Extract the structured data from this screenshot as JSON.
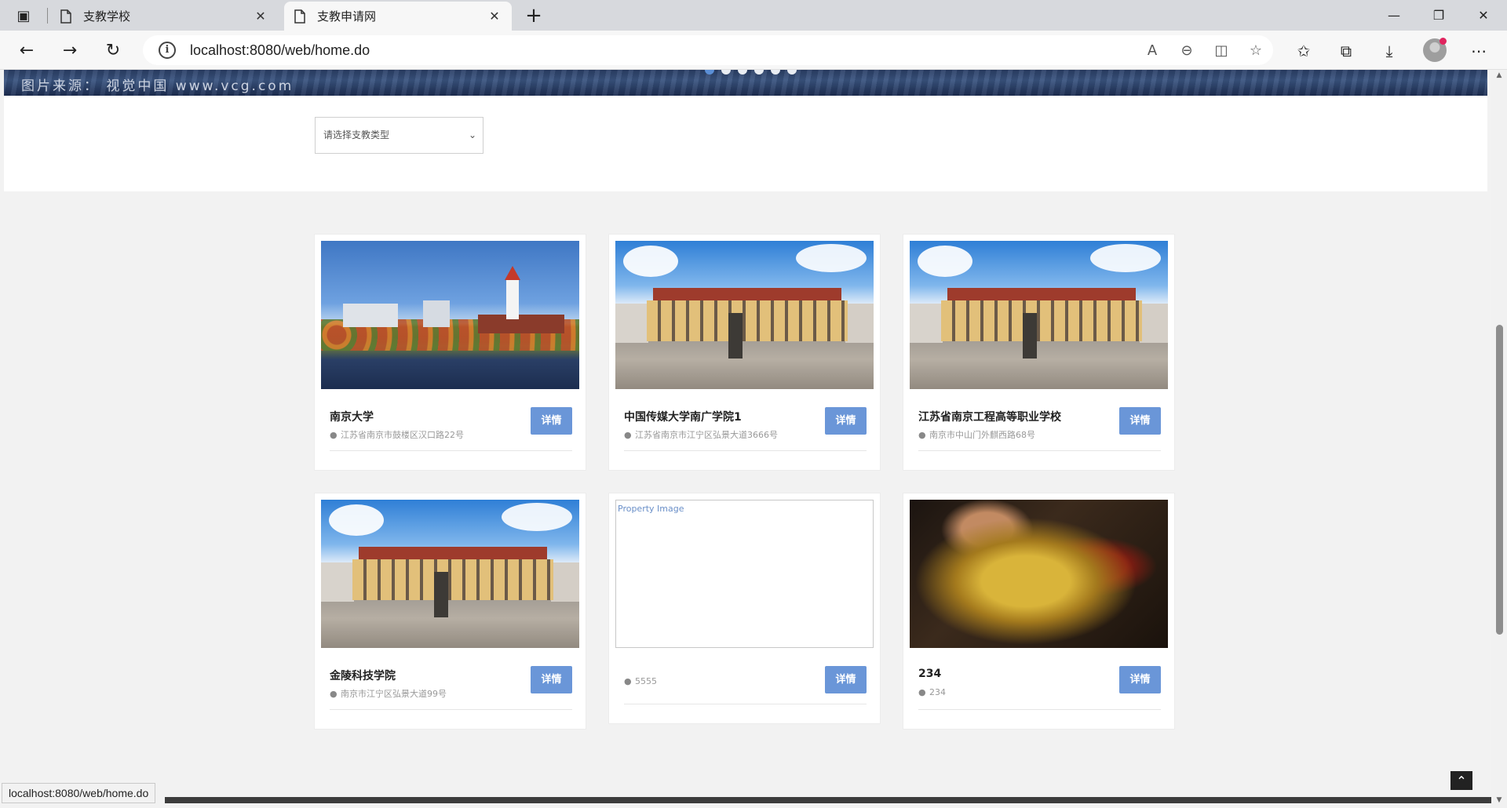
{
  "browser": {
    "tabs": [
      {
        "title": "支教学校",
        "active": false
      },
      {
        "title": "支教申请网",
        "active": true
      }
    ],
    "url": "localhost:8080/web/home.do",
    "status_url": "localhost:8080/web/home.do"
  },
  "banner": {
    "credit": "图片来源： 视觉中国 www.vcg.com",
    "dot_count": 6,
    "active_dot": 0
  },
  "filter": {
    "type_select_placeholder": "请选择支教类型"
  },
  "schools": [
    {
      "name": "南京大学",
      "address": "江苏省南京市鼓楼区汉口路22号",
      "button": "详情",
      "image": "harvard-photo"
    },
    {
      "name": "中国传媒大学南广学院1",
      "address": "江苏省南京市江宁区弘景大道3666号",
      "button": "详情",
      "image": "palace-photo"
    },
    {
      "name": "江苏省南京工程高等职业学校",
      "address": "南京市中山门外麒西路68号",
      "button": "详情",
      "image": "palace-photo"
    },
    {
      "name": "金陵科技学院",
      "address": "南京市江宁区弘景大道99号",
      "button": "详情",
      "image": "palace-photo"
    },
    {
      "name": "",
      "address": "5555",
      "button": "详情",
      "image": "broken-image",
      "image_alt": "Property Image"
    },
    {
      "name": "234",
      "address": "234",
      "button": "详情",
      "image": "game-art"
    }
  ],
  "icons": {
    "tab_actions": "tab-actions-icon",
    "page": "document-icon",
    "close": "close-icon",
    "new_tab": "plus-icon",
    "back": "back-arrow-icon",
    "forward": "forward-arrow-icon",
    "reload": "reload-icon",
    "site_info": "info-icon",
    "location": "map-pin-icon",
    "back_to_top": "chevron-up-icon"
  }
}
